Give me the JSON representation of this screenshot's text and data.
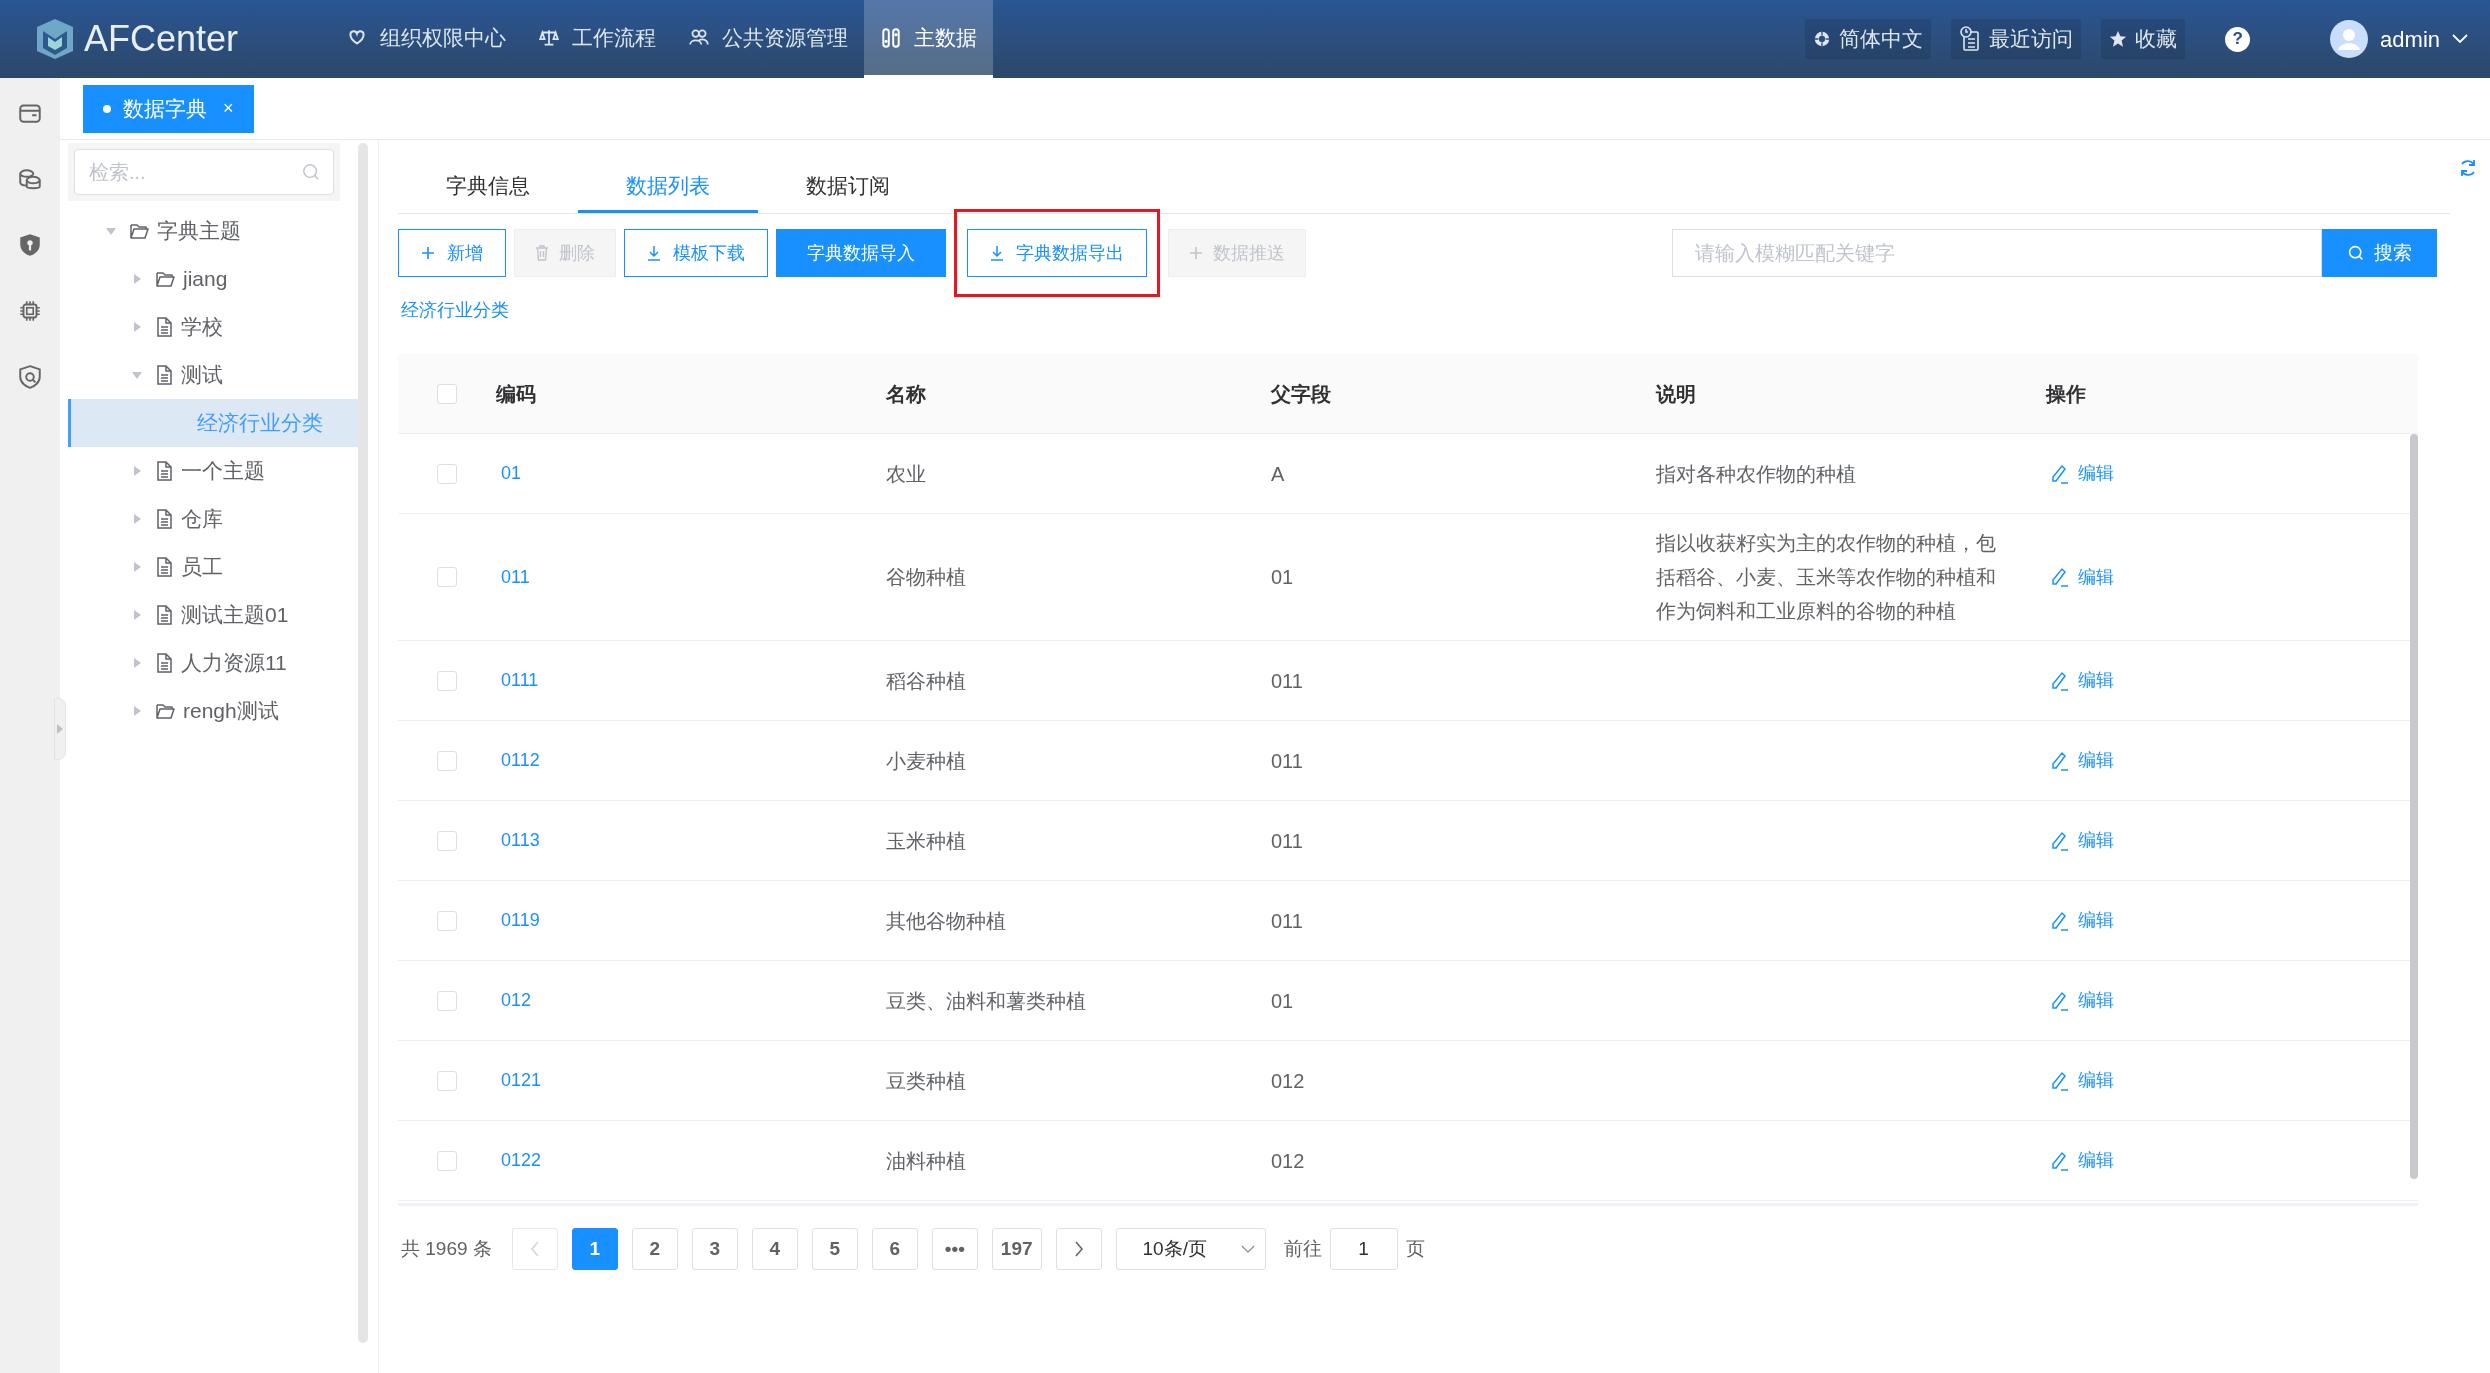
{
  "header": {
    "logo_text": "AFCenter",
    "nav": [
      {
        "label": "组织权限中心",
        "selected": false
      },
      {
        "label": "工作流程",
        "selected": false
      },
      {
        "label": "公共资源管理",
        "selected": false
      },
      {
        "label": "主数据",
        "selected": true
      }
    ],
    "language": "简体中文",
    "recent": "最近访问",
    "favorites": "收藏",
    "help": "?",
    "user": "admin"
  },
  "page_tabs": [
    {
      "label": "数据字典",
      "selected": true,
      "close": "×"
    }
  ],
  "tree": {
    "search_placeholder": "检索...",
    "nodes": [
      {
        "label": "字典主题",
        "kind": "folder",
        "expanded": true,
        "selected": false,
        "children": [
          {
            "label": "jiang",
            "kind": "folder",
            "expanded": false,
            "selected": false
          },
          {
            "label": "学校",
            "kind": "file",
            "expanded": false,
            "selected": false
          },
          {
            "label": "测试",
            "kind": "file",
            "expanded": true,
            "selected": false,
            "children": [
              {
                "label": "经济行业分类",
                "kind": "item",
                "expanded": false,
                "selected": true
              }
            ]
          },
          {
            "label": "一个主题",
            "kind": "file",
            "expanded": false,
            "selected": false
          },
          {
            "label": "仓库",
            "kind": "file",
            "expanded": false,
            "selected": false
          },
          {
            "label": "员工",
            "kind": "file",
            "expanded": false,
            "selected": false
          },
          {
            "label": "测试主题01",
            "kind": "file",
            "expanded": false,
            "selected": false
          },
          {
            "label": "人力资源11",
            "kind": "file",
            "expanded": false,
            "selected": false
          },
          {
            "label": "rengh测试",
            "kind": "folder",
            "expanded": false,
            "selected": false
          }
        ]
      }
    ]
  },
  "content_tabs": [
    {
      "label": "字典信息",
      "selected": false
    },
    {
      "label": "数据列表",
      "selected": true
    },
    {
      "label": "数据订阅",
      "selected": false
    }
  ],
  "toolbar": [
    {
      "label": "新增",
      "kind": "add",
      "disabled": false,
      "highlighted": false
    },
    {
      "label": "删除",
      "kind": "delete",
      "disabled": true,
      "highlighted": false
    },
    {
      "label": "模板下载",
      "kind": "download",
      "disabled": false,
      "highlighted": false
    },
    {
      "label": "字典数据导入",
      "kind": "primary",
      "disabled": false,
      "highlighted": false
    },
    {
      "label": "字典数据导出",
      "kind": "download",
      "disabled": false,
      "highlighted": true
    },
    {
      "label": "数据推送",
      "kind": "add",
      "disabled": true,
      "highlighted": false
    }
  ],
  "search": {
    "placeholder": "请输入模糊匹配关键字",
    "button": "搜索"
  },
  "breadcrumb": "经济行业分类",
  "table": {
    "columns": [
      "编码",
      "名称",
      "父字段",
      "说明",
      "操作"
    ],
    "header_checked": false,
    "rows": [
      {
        "checked": false,
        "code": "01",
        "name": "农业",
        "parent": "A",
        "description": "指对各种农作物的种植",
        "action": "编辑"
      },
      {
        "checked": false,
        "code": "011",
        "name": "谷物种植",
        "parent": "01",
        "description": "指以收获籽实为主的农作物的种植，包括稻谷、小麦、玉米等农作物的种植和作为饲料和工业原料的谷物的种植",
        "action": "编辑"
      },
      {
        "checked": false,
        "code": "0111",
        "name": "稻谷种植",
        "parent": "011",
        "action": "编辑"
      },
      {
        "checked": false,
        "code": "0112",
        "name": "小麦种植",
        "parent": "011",
        "action": "编辑"
      },
      {
        "checked": false,
        "code": "0113",
        "name": "玉米种植",
        "parent": "011",
        "action": "编辑"
      },
      {
        "checked": false,
        "code": "0119",
        "name": "其他谷物种植",
        "parent": "011",
        "action": "编辑"
      },
      {
        "checked": false,
        "code": "012",
        "name": "豆类、油料和薯类种植",
        "parent": "01",
        "action": "编辑"
      },
      {
        "checked": false,
        "code": "0121",
        "name": "豆类种植",
        "parent": "012",
        "action": "编辑"
      },
      {
        "checked": false,
        "code": "0122",
        "name": "油料种植",
        "parent": "012",
        "action": "编辑"
      }
    ]
  },
  "pagination": {
    "total": "共 1969 条",
    "prev_disabled": true,
    "pages": [
      {
        "label": "1",
        "selected": true
      },
      {
        "label": "2",
        "selected": false
      },
      {
        "label": "3",
        "selected": false
      },
      {
        "label": "4",
        "selected": false
      },
      {
        "label": "5",
        "selected": false
      },
      {
        "label": "6",
        "selected": false
      },
      {
        "label": "•••",
        "selected": false
      },
      {
        "label": "197",
        "selected": false
      }
    ],
    "page_size": "10条/页",
    "goto_label": "前往",
    "goto_value": "1",
    "goto_suffix": "页"
  }
}
